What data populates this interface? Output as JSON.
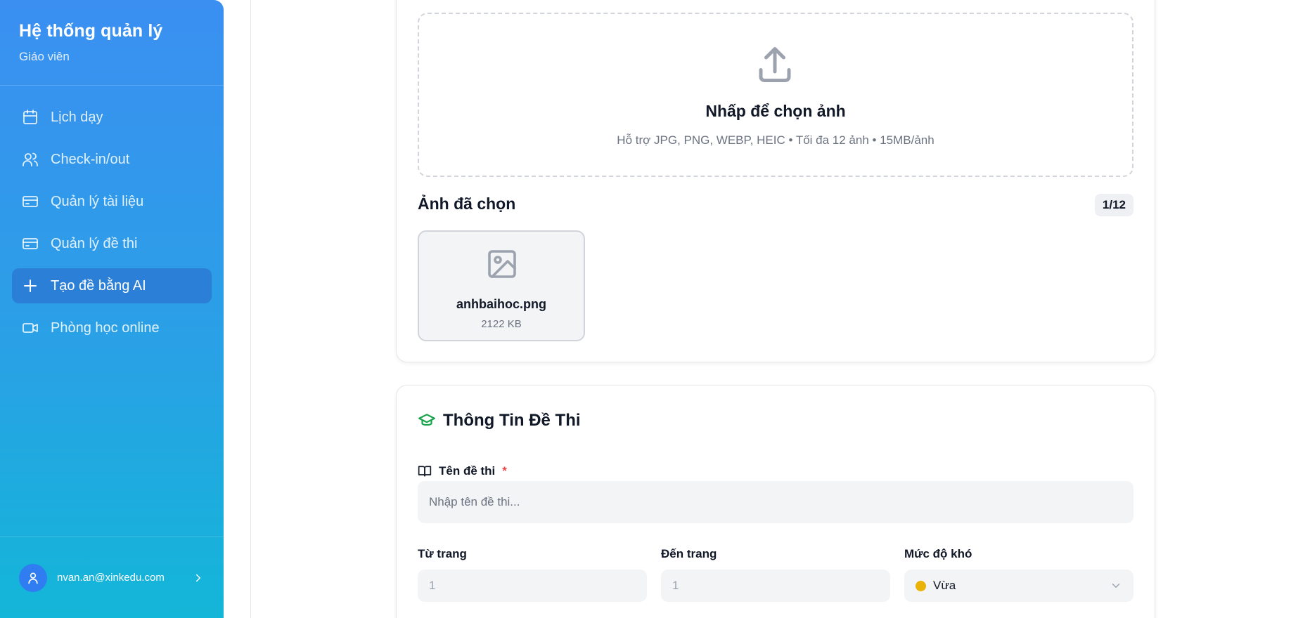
{
  "sidebar": {
    "title": "Hệ thống quản lý",
    "subtitle": "Giáo viên",
    "items": [
      {
        "label": "Lịch dạy",
        "icon": "calendar-icon"
      },
      {
        "label": "Check-in/out",
        "icon": "users-icon"
      },
      {
        "label": "Quản lý tài liệu",
        "icon": "document-icon"
      },
      {
        "label": "Quản lý đề thi",
        "icon": "exam-icon"
      },
      {
        "label": "Tạo đề bằng AI",
        "icon": "plus-icon",
        "active": true
      },
      {
        "label": "Phòng học online",
        "icon": "video-icon"
      }
    ],
    "user_email": "nvan.an@xinkedu.com"
  },
  "upload": {
    "title": "Nhấp để chọn ảnh",
    "hint": "Hỗ trợ JPG, PNG, WEBP, HEIC • Tối đa 12 ảnh • 15MB/ảnh"
  },
  "selected": {
    "title": "Ảnh đã chọn",
    "count": "1/12",
    "files": [
      {
        "name": "anhbaihoc.png",
        "size": "2122 KB"
      }
    ]
  },
  "exam_info": {
    "title": "Thông Tin Đề Thi",
    "name_label": "Tên đề thi",
    "required_mark": "*",
    "name_placeholder": "Nhập tên đề thi...",
    "from_page_label": "Từ trang",
    "from_page_value": "1",
    "to_page_label": "Đến trang",
    "to_page_value": "1",
    "difficulty_label": "Mức độ khó",
    "difficulty_value": "Vừa"
  },
  "colors": {
    "accent": "#3b8ff1",
    "active_nav": "#2c7fd6",
    "section_icon": "#16a34a",
    "difficulty_dot": "#eab308",
    "required": "#ef4444"
  }
}
